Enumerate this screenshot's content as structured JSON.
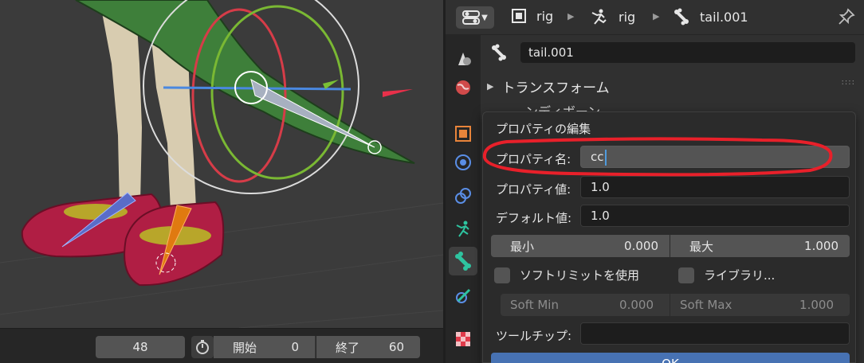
{
  "timeline": {
    "current_frame": "48",
    "start_label": "開始",
    "start_value": "0",
    "end_label": "終了",
    "end_value": "60"
  },
  "header": {
    "breadcrumbs": [
      {
        "label": "rig",
        "icon": "object-icon"
      },
      {
        "label": "rig",
        "icon": "armature-icon"
      },
      {
        "label": "tail.001",
        "icon": "bone-icon"
      }
    ]
  },
  "panel": {
    "bone_name": "tail.001",
    "transform_label": "トランスフォーム",
    "partially_hidden_label": "ンディボーン"
  },
  "dialog": {
    "title": "プロパティの編集",
    "property_name_label": "プロパティ名:",
    "property_name_value": "cc",
    "property_value_label": "プロパティ値:",
    "property_value": "1.0",
    "default_value_label": "デフォルト値:",
    "default_value": "1.0",
    "min_label": "最小",
    "min_value": "0.000",
    "max_label": "最大",
    "max_value": "1.000",
    "soft_limit_label": "ソフトリミットを使用",
    "library_label": "ライブラリ...",
    "soft_min_label": "Soft Min",
    "soft_min_value": "0.000",
    "soft_max_label": "Soft Max",
    "soft_max_value": "1.000",
    "tooltip_label": "ツールチップ:",
    "tooltip_value": "",
    "ok_label": "OK"
  },
  "colors": {
    "accent": "#4772b3",
    "active_bone_orange": "#e07a10",
    "tab_active": "#3f3f3f",
    "annotation_red": "#e8202a"
  }
}
